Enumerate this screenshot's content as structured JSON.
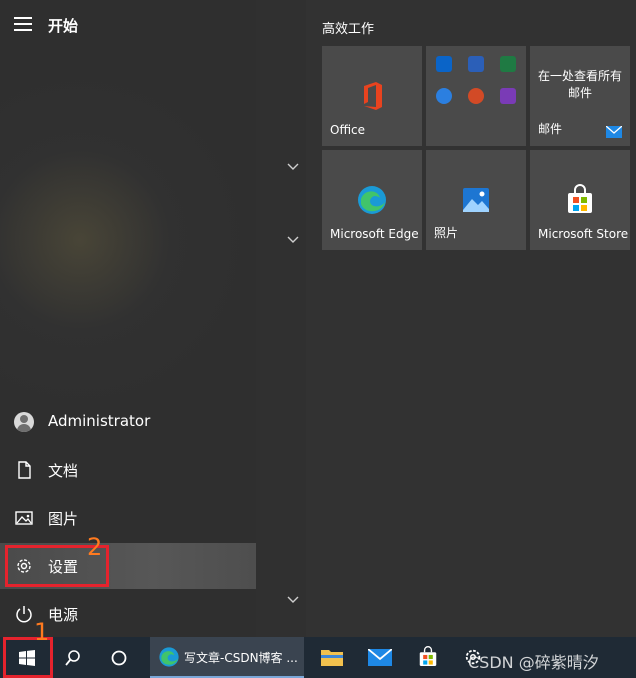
{
  "start_menu": {
    "title": "开始",
    "user_name": "Administrator",
    "items": {
      "documents": "文档",
      "pictures": "图片",
      "settings": "设置",
      "power": "电源"
    },
    "group_title": "高效工作",
    "tiles": {
      "office": "Office",
      "mail_preview": "在一处查看所有邮件",
      "mail": "邮件",
      "edge": "Microsoft Edge",
      "photos": "照片",
      "store": "Microsoft Store"
    }
  },
  "annotations": {
    "marker_1": "1",
    "marker_2": "2",
    "highlight_color": "#e5232d",
    "marker_color": "#ff7a1f"
  },
  "taskbar": {
    "active_app_label": "写文章-CSDN博客 ...",
    "watermark": "CSDN @碎紫晴汐"
  },
  "colors": {
    "taskbar_bg": "#1f2a35",
    "tile_bg": "#4a4a4a",
    "accent_blue": "#0078d7"
  }
}
